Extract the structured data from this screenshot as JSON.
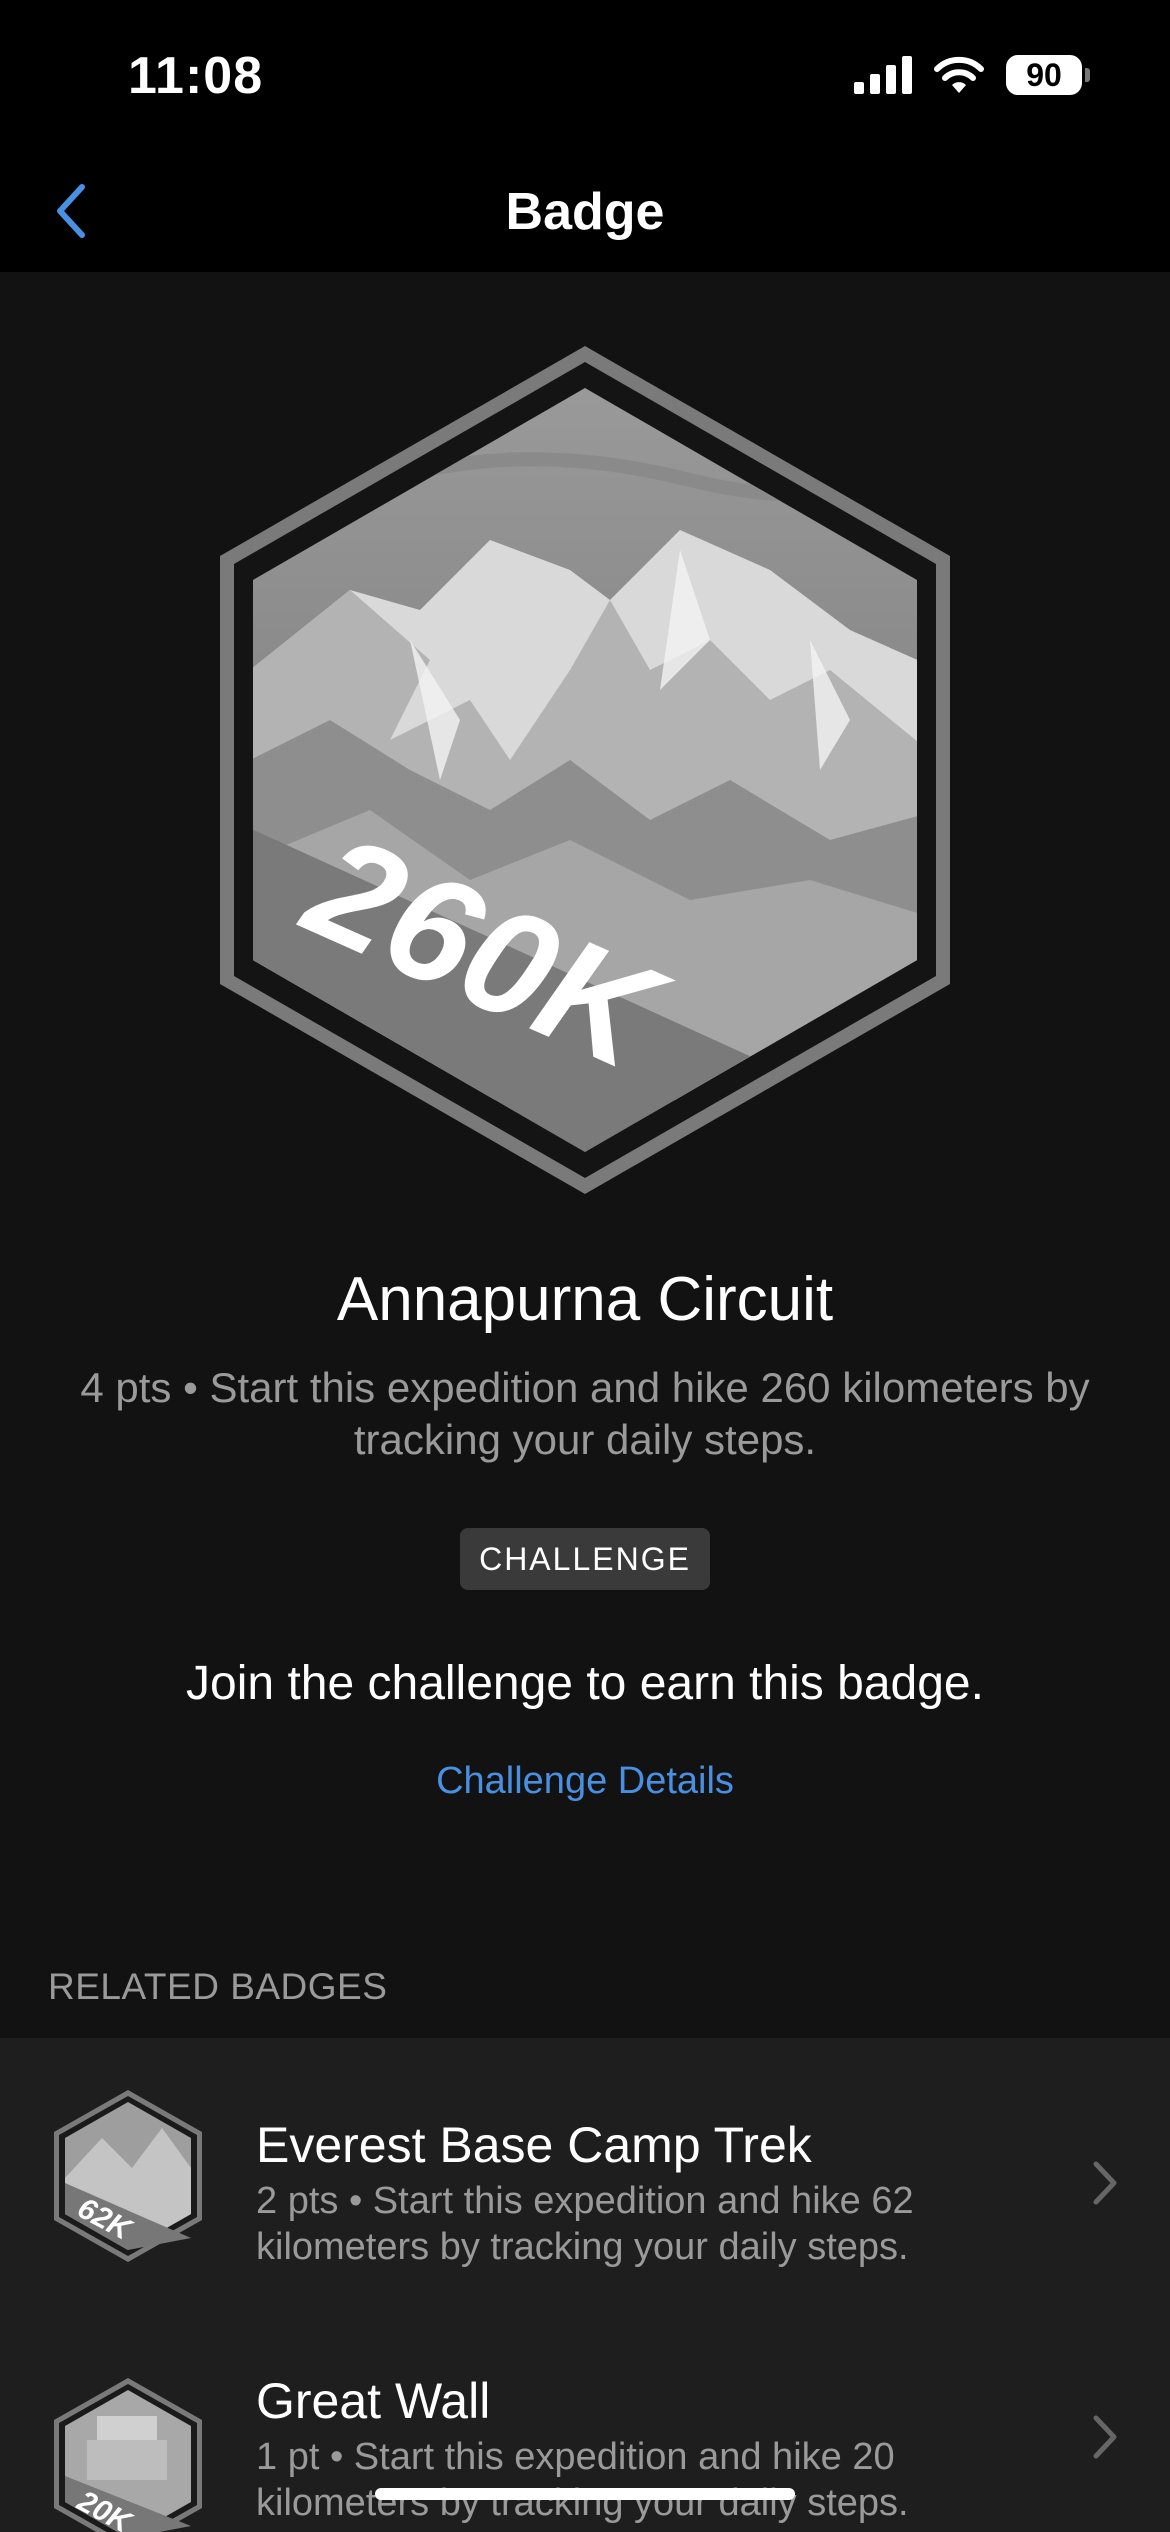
{
  "status": {
    "time": "11:08",
    "battery": "90"
  },
  "nav": {
    "title": "Badge"
  },
  "badge": {
    "art_label": "260K",
    "name": "Annapurna Circuit",
    "description": "4 pts • Start this expedition and hike 260 kilometers by tracking your daily steps.",
    "tag": "CHALLENGE",
    "join_text": "Join the challenge to earn this badge.",
    "details_link": "Challenge Details"
  },
  "related": {
    "header": "RELATED BADGES",
    "items": [
      {
        "icon_label": "62K",
        "title": "Everest Base Camp Trek",
        "description": "2 pts • Start this expedition and hike 62 kilometers by tracking your daily steps."
      },
      {
        "icon_label": "20K",
        "title": "Great Wall",
        "description": "1 pt • Start this expedition and hike 20 kilometers by tracking your daily steps."
      }
    ]
  },
  "colors": {
    "accent": "#4a90e2",
    "background": "#121212",
    "bar": "#000000",
    "secondary_text": "#9a9a9a"
  }
}
